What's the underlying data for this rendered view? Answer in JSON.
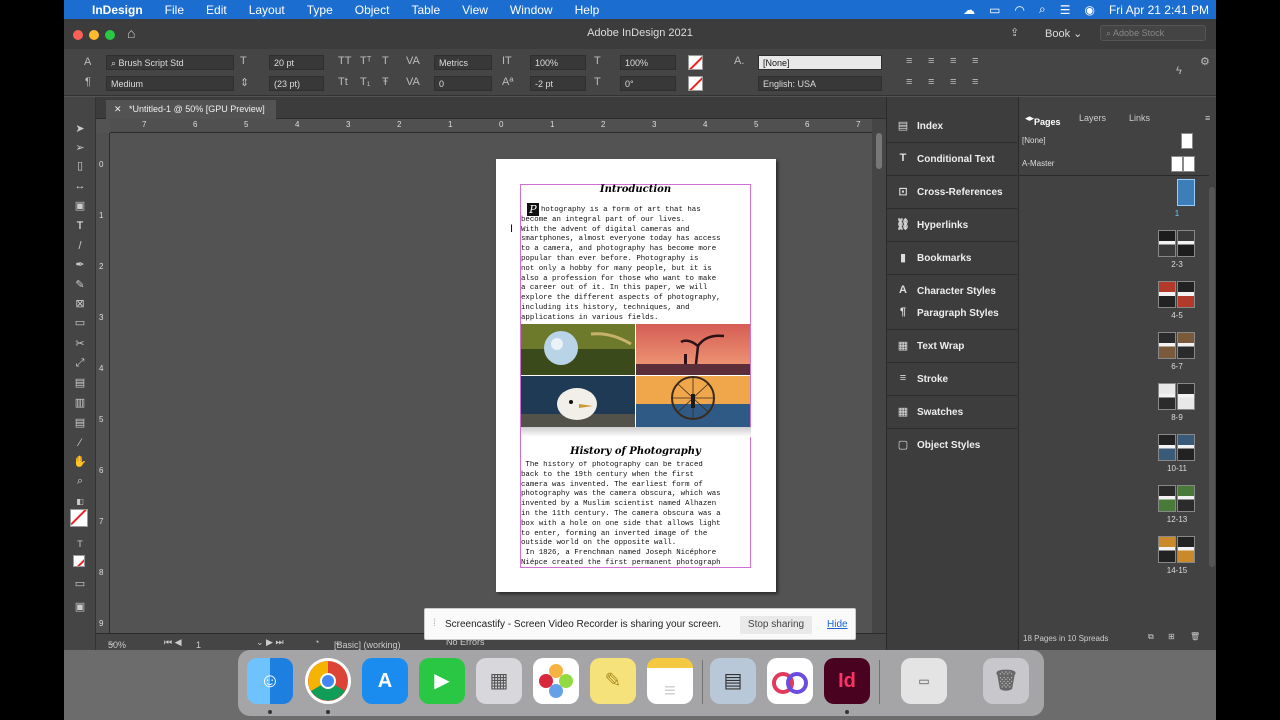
{
  "menubar": {
    "app_name": "InDesign",
    "items": [
      "File",
      "Edit",
      "Layout",
      "Type",
      "Object",
      "Table",
      "View",
      "Window",
      "Help"
    ],
    "datetime": "Fri Apr 21  2:41 PM"
  },
  "window": {
    "title": "Adobe InDesign 2021",
    "workspace": "Book",
    "stock_search_placeholder": "Adobe Stock"
  },
  "control": {
    "font_family": "Brush Script Std",
    "font_style": "Medium",
    "font_size": "20 pt",
    "leading": "(23 pt)",
    "kerning": "Metrics",
    "tracking": "0",
    "vertical_scale": "100%",
    "horizontal_scale": "100%",
    "baseline_shift": "-2 pt",
    "skew": "0°",
    "char_style": "[None]",
    "language": "English: USA"
  },
  "document": {
    "tab_label": "*Untitled-1 @ 50% [GPU Preview]",
    "hruler_labels": [
      "7",
      "6",
      "5",
      "4",
      "3",
      "2",
      "1",
      "0",
      "1",
      "2",
      "3",
      "4",
      "5",
      "6",
      "7"
    ],
    "vruler_labels": [
      "0",
      "1",
      "2",
      "3",
      "4",
      "5",
      "6",
      "7",
      "8",
      "9"
    ],
    "page": {
      "title1": "Introduction",
      "dropcap": "P",
      "para1": "hotography is a form of art that has\nbecome an integral part of our lives.\nWith the advent of digital cameras and\nsmartphones, almost everyone today has access\nto a camera, and photography has become more\npopular than ever before. Photography is\nnot only a hobby for many people, but it is\nalso a profession for those who want to make\na career out of it. In this paper, we will\nexplore the different aspects of photography,\nincluding its history, techniques, and\napplications in various fields.",
      "title2": "History of Photography",
      "para2": " The history of photography can be traced\nback to the 19th century when the first\ncamera was invented. The earliest form of\nphotography was the camera obscura, which was\ninvented by a Muslim scientist named Alhazen\nin the 11th century. The camera obscura was a\nbox with a hole on one side that allows light\nto enter, forming an inverted image of the\noutside world on the opposite wall.\n In 1826, a Frenchman named Joseph Nicéphore\nNiépce created the first permanent photograph"
    }
  },
  "status": {
    "zoom": "50%",
    "page_number": "1",
    "preflight_profile": "[Basic] (working)",
    "preflight_state": "No Errors"
  },
  "midpanel": {
    "items": [
      "Index",
      "Conditional Text",
      "Cross-References",
      "Hyperlinks",
      "Bookmarks",
      "Character Styles",
      "Paragraph Styles",
      "Text Wrap",
      "Stroke",
      "Swatches",
      "Object Styles"
    ]
  },
  "pages_panel": {
    "tabs": [
      "Pages",
      "Layers",
      "Links"
    ],
    "masters": [
      "[None]",
      "A-Master"
    ],
    "spread_labels": [
      "1",
      "2-3",
      "4-5",
      "6-7",
      "8-9",
      "10-11",
      "12-13",
      "14-15"
    ],
    "footer": "18 Pages in 10 Spreads"
  },
  "notification": {
    "message": "Screencastify - Screen Video Recorder is sharing your screen.",
    "stop_label": "Stop sharing",
    "hide_label": "Hide"
  },
  "dock": {
    "indesign_label": "Id"
  }
}
